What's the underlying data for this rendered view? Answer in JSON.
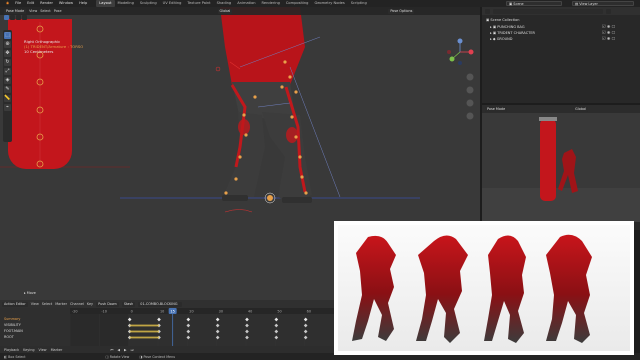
{
  "menu": [
    "File",
    "Edit",
    "Render",
    "Window",
    "Help"
  ],
  "workspaces": [
    "Layout",
    "Modeling",
    "Sculpting",
    "UV Editing",
    "Texture Paint",
    "Shading",
    "Animation",
    "Rendering",
    "Compositing",
    "Geometry Nodes",
    "Scripting"
  ],
  "active_workspace": "Layout",
  "scene": "Scene",
  "view_layer": "View Layer",
  "viewport": {
    "mode": "Pose Mode",
    "menus": [
      "View",
      "Select",
      "Pose"
    ],
    "transform": "Global",
    "options": "Pose Options",
    "info_line1": "Right Orthographic",
    "info_line2": "(1) TRIDENT/Armature : TORSO",
    "info_line3": "10 Centimeters",
    "footer": "Move"
  },
  "outliner": {
    "title": "Scene Collection",
    "rows": [
      "PUNCHING BAG",
      "TRIDENT CHARACTER",
      "GROUND"
    ]
  },
  "preview_header": {
    "mode": "Pose Mode",
    "transform": "Global"
  },
  "action_editor": {
    "mode": "Action Editor",
    "menus": [
      "View",
      "Select",
      "Marker",
      "Channel",
      "Key"
    ],
    "push_down": "Push Down",
    "stash": "Stash",
    "action_name": "01-COMBO-BLOCKING",
    "frames": [
      "-20",
      "-10",
      "0",
      "10",
      "20",
      "30",
      "40",
      "50",
      "60"
    ],
    "current_frame": "15",
    "channels": [
      "Summary",
      "VISIBILITY",
      "FOOT.MAIN",
      "ROOT"
    ]
  },
  "playback": [
    "Playback",
    "Keying",
    "View",
    "Marker"
  ],
  "status": [
    "Box Select",
    "Rotate View",
    "Pose Context Menu"
  ],
  "colors": {
    "accent": "#4772b3",
    "orange": "#e8a04a",
    "red": "#c0181c",
    "yellow": "#e5c34a"
  }
}
